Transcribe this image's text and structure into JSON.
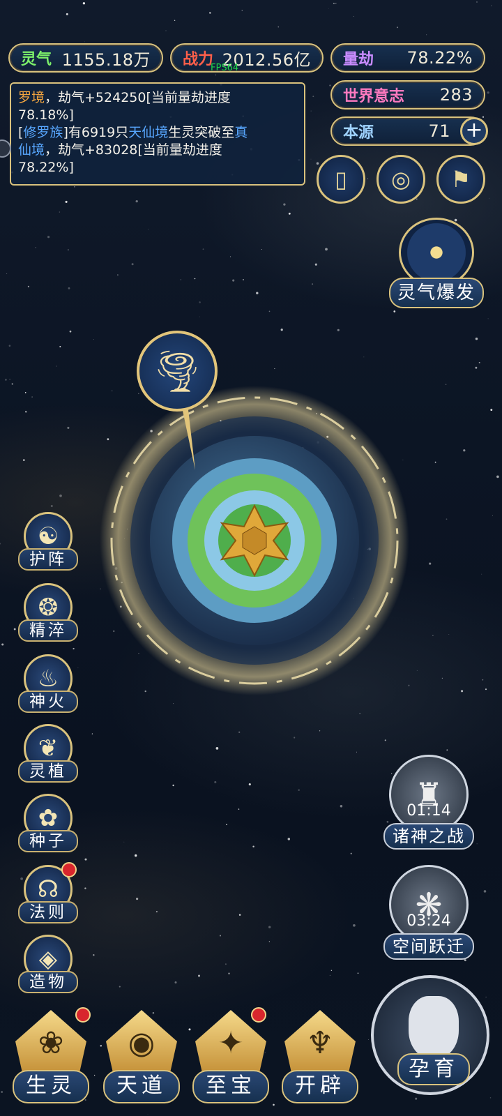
{
  "stats": {
    "lingqi": {
      "label": "灵气",
      "value": "1155.18万"
    },
    "zhanli": {
      "label": "战力",
      "value": "2012.56亿"
    },
    "liangjie": {
      "label": "量劫",
      "value": "78.22%"
    },
    "world_will": {
      "label": "世界意志",
      "value": "283"
    },
    "origin": {
      "label": "本源",
      "value": "71"
    }
  },
  "fps": "FPS64",
  "log": {
    "line1_a": "罗境",
    "line1_b": "，劫气+524250[当前量劫进度",
    "line1_c": "78.18%]",
    "line2_a": "[",
    "line2_b": "修罗族",
    "line2_c": "]有6919只",
    "line2_d": "天仙境",
    "line2_e": "生灵突破至",
    "line2_f": "真",
    "line2_g": "仙境",
    "line2_h": "，劫气+83028[当前量劫进度",
    "line2_i": "78.22%]"
  },
  "top_buttons": {
    "b1_icon": "▯",
    "b2_icon": "◎",
    "b3_icon": "⚑"
  },
  "burst": {
    "label": "灵气爆发"
  },
  "side_menu": [
    {
      "label": "护阵",
      "icon": "☯"
    },
    {
      "label": "精淬",
      "icon": "❂"
    },
    {
      "label": "神火",
      "icon": "♨"
    },
    {
      "label": "灵植",
      "icon": "❦"
    },
    {
      "label": "种子",
      "icon": "✿"
    },
    {
      "label": "法则",
      "icon": "☊"
    },
    {
      "label": "造物",
      "icon": "◈"
    }
  ],
  "timers": [
    {
      "label": "诸神之战",
      "time": "01:14",
      "icon": "♜"
    },
    {
      "label": "空间跃迁",
      "time": "03:24",
      "icon": "❋"
    }
  ],
  "bottom_menu": [
    {
      "label": "生灵",
      "icon": "❀"
    },
    {
      "label": "天道",
      "icon": "◉"
    },
    {
      "label": "至宝",
      "icon": "✦"
    },
    {
      "label": "开辟",
      "icon": "♆"
    }
  ],
  "nurture": {
    "label": "孕育"
  },
  "colors": {
    "gold": "#d9c27d",
    "panel": "#17304f",
    "badge": "#d8262d",
    "orange_text": "#f2a540",
    "blue_text": "#58a7ff",
    "fps": "#1fd94b"
  }
}
